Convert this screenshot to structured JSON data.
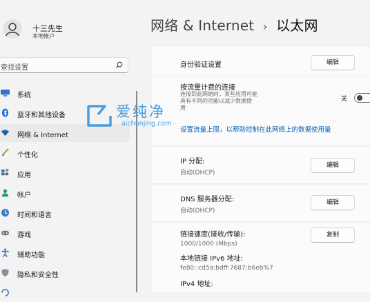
{
  "user": {
    "name": "十三先生",
    "account_type": "本地帐户"
  },
  "search": {
    "placeholder": "查找设置"
  },
  "sidebar": {
    "items": [
      {
        "label": "系统",
        "icon": "monitor-icon"
      },
      {
        "label": "蓝牙和其他设备",
        "icon": "bluetooth-icon"
      },
      {
        "label": "网络 & Internet",
        "icon": "wifi-icon",
        "active": true
      },
      {
        "label": "个性化",
        "icon": "brush-icon"
      },
      {
        "label": "应用",
        "icon": "apps-icon"
      },
      {
        "label": "帐户",
        "icon": "person-icon"
      },
      {
        "label": "时间和语言",
        "icon": "globe-clock-icon"
      },
      {
        "label": "游戏",
        "icon": "gamepad-icon"
      },
      {
        "label": "辅助功能",
        "icon": "accessibility-icon"
      },
      {
        "label": "隐私和安全性",
        "icon": "shield-icon"
      }
    ]
  },
  "header": {
    "parent": "网络 & Internet",
    "separator": "›",
    "current": "以太网"
  },
  "main": {
    "auth": {
      "label": "身份验证设置",
      "button": "编辑"
    },
    "metered": {
      "label": "按流量计费的连接",
      "description": [
        "连接到此网络时，某些应用可能",
        "具有不同的功能以减少数据使",
        "用"
      ],
      "toggle_state": "关",
      "toggle_on": false
    },
    "data_limit_link": "设置流量上限，以帮助控制在此网络上的数据使用量",
    "ip_assignment": {
      "label": "IP 分配:",
      "value": "自动(DHCP)",
      "button": "编辑"
    },
    "dns_assignment": {
      "label": "DNS 服务器分配:",
      "value": "自动(DHCP)",
      "button": "编辑"
    },
    "properties": {
      "link_speed_label": "链接速度(接收/传输):",
      "link_speed_value": "1000/1000 (Mbps)",
      "ipv6_label": "本地链接 IPv6 地址:",
      "ipv6_value": "fe80::cd5a:bdff:7687:b6eb%7",
      "ipv4_label": "IPv4 地址:",
      "button": "复制"
    }
  },
  "watermark": {
    "name": "爱纯净",
    "url": "aichunjing.com"
  },
  "colors": {
    "accent": "#0a5fb8",
    "watermark": "#2e8fd9",
    "background": "#f3f3f3",
    "card": "#fbfbfb"
  }
}
